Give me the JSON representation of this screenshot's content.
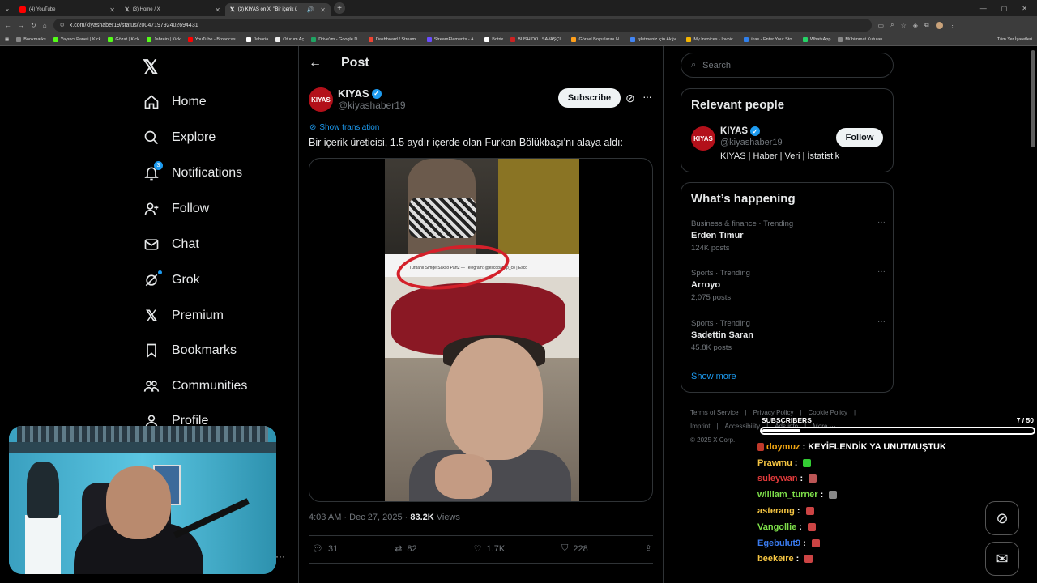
{
  "browser": {
    "tabs": [
      {
        "label": "(4) YouTube",
        "color": "#ff0000"
      },
      {
        "label": "(3) Home / X",
        "color": "#000000"
      },
      {
        "label": "(3) KIYAS on X: \"Bir içerik ü",
        "color": "#000000"
      }
    ],
    "url": "x.com/kiyashaber19/status/2004719792402694431",
    "bookmarks": [
      "Bookmarks",
      "Yayıncı Paneli | Kick",
      "Gözat | Kick",
      "Jahrein | Kick",
      "YouTube - Broadcas...",
      "Jaharia",
      "Oturum Aç",
      "Drive'ım - Google D...",
      "Dashboard / Stream...",
      "StreamElements - A...",
      "Botrix",
      "BUSHIDO | SAVAŞÇI...",
      "Görsel Boyutlarını N...",
      "İşletmeniz için Akıjv...",
      "My Invoices - Invoic...",
      "ikas - Enter Your Sto...",
      "WhatsApp",
      "Mühimmat Kutuları..."
    ],
    "bookmarks_right": "Tüm Yer İşaretleri"
  },
  "nav": {
    "items": [
      {
        "label": "Home",
        "icon": "home-icon"
      },
      {
        "label": "Explore",
        "icon": "search-icon"
      },
      {
        "label": "Notifications",
        "icon": "bell-icon",
        "badge": "3"
      },
      {
        "label": "Follow",
        "icon": "person-add-icon"
      },
      {
        "label": "Chat",
        "icon": "mail-icon"
      },
      {
        "label": "Grok",
        "icon": "grok-icon"
      },
      {
        "label": "Premium",
        "icon": "x-icon"
      },
      {
        "label": "Bookmarks",
        "icon": "bookmark-icon"
      },
      {
        "label": "Communities",
        "icon": "communities-icon"
      },
      {
        "label": "Profile",
        "icon": "profile-icon"
      }
    ]
  },
  "post": {
    "header": "Post",
    "avatar_text": "KIYAS",
    "author_name": "KIYAS",
    "author_handle": "@kiyashaber19",
    "subscribe_label": "Subscribe",
    "show_translation": "Show translation",
    "text": "Bir içerik üreticisi, 1.5 aydır içerde olan Furkan Bölükbaşı'nı alaya aldı:",
    "video_caption": "Türbanlı Simge Sakso Part2 — Telegram: @escobarvip_co | Esco",
    "time": "4:03 AM · Dec 27, 2025 · ",
    "views_count": "83.2K",
    "views_label": " Views",
    "replies": "31",
    "reposts": "82",
    "likes": "1.7K",
    "bookmarks": "228"
  },
  "right": {
    "search_placeholder": "Search",
    "relevant_title": "Relevant people",
    "person": {
      "avatar_text": "KIYAS",
      "name": "KIYAS",
      "handle": "@kiyashaber19",
      "bio": "KIYAS | Haber | Veri | İstatistik",
      "follow_label": "Follow"
    },
    "happening_title": "What’s happening",
    "trends": [
      {
        "category": "Business & finance · Trending",
        "name": "Erden Timur",
        "posts": "124K posts"
      },
      {
        "category": "Sports · Trending",
        "name": "Arroyo",
        "posts": "2,075 posts"
      },
      {
        "category": "Sports · Trending",
        "name": "Sadettin Saran",
        "posts": "45.8K posts"
      }
    ],
    "show_more": "Show more",
    "footer": {
      "line1": [
        "Terms of Service",
        "|",
        "Privacy Policy",
        "|",
        "Cookie Policy",
        "|"
      ],
      "line2": [
        "Imprint",
        "|",
        "Accessibility",
        "|",
        "Ads info",
        "|",
        "More ···"
      ],
      "copyright": "© 2025 X Corp."
    }
  },
  "overlay": {
    "subs_label": "SUBSCRIBERS",
    "subs_count": "7 / 50",
    "subs_progress": 0.14,
    "chat": [
      {
        "user": "doymuz",
        "color": "#f3a712",
        "msg": "KEYİFLENDİK YA UNUTMUŞTUK"
      },
      {
        "user": "Prawmu",
        "color": "#f5c542",
        "msg": ""
      },
      {
        "user": "suleywan",
        "color": "#e03a3a",
        "msg": ""
      },
      {
        "user": "william_turner",
        "color": "#7ee04a",
        "msg": ""
      },
      {
        "user": "asterang",
        "color": "#f5c542",
        "msg": ""
      },
      {
        "user": "Vangollie",
        "color": "#7ee04a",
        "msg": ""
      },
      {
        "user": "Egebulut9",
        "color": "#3a7bf0",
        "msg": ""
      },
      {
        "user": "beekeire",
        "color": "#f5c542",
        "msg": ""
      }
    ]
  }
}
